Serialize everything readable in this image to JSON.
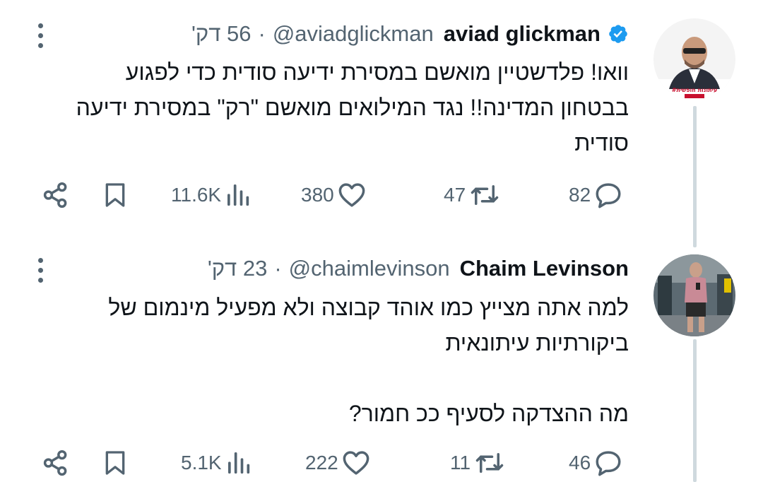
{
  "tweets": [
    {
      "name": "aviad glickman",
      "handle": "@aviadglickman",
      "time": "56 דק'",
      "text": "וואו! פלדשטיין מואשם במסירת ידיעה סודית כדי לפגוע בבטחון המדינה!! נגד המילואים מואשם \"רק\" במסירת ידיעה סודית",
      "verified": true,
      "avatar_icon": "person-avatar-icon",
      "stats": {
        "replies": "82",
        "retweets": "47",
        "likes": "380",
        "views": "11.6K"
      }
    },
    {
      "name": "Chaim Levinson",
      "handle": "@chaimlevinson",
      "time": "23 דק'",
      "text": "למה אתה מצייץ כמו אוהד קבוצה ולא מפעיל מינמום של ביקורתיות עיתונאית\n\nמה ההצדקה לסעיף ככ חמור?",
      "verified": false,
      "avatar_icon": "person-avatar-icon",
      "stats": {
        "replies": "46",
        "retweets": "11",
        "likes": "222",
        "views": "5.1K"
      }
    }
  ],
  "colors": {
    "text": "#0f1419",
    "secondary": "#536471",
    "verified": "#1d9bf0",
    "thread": "#cfd9de"
  }
}
